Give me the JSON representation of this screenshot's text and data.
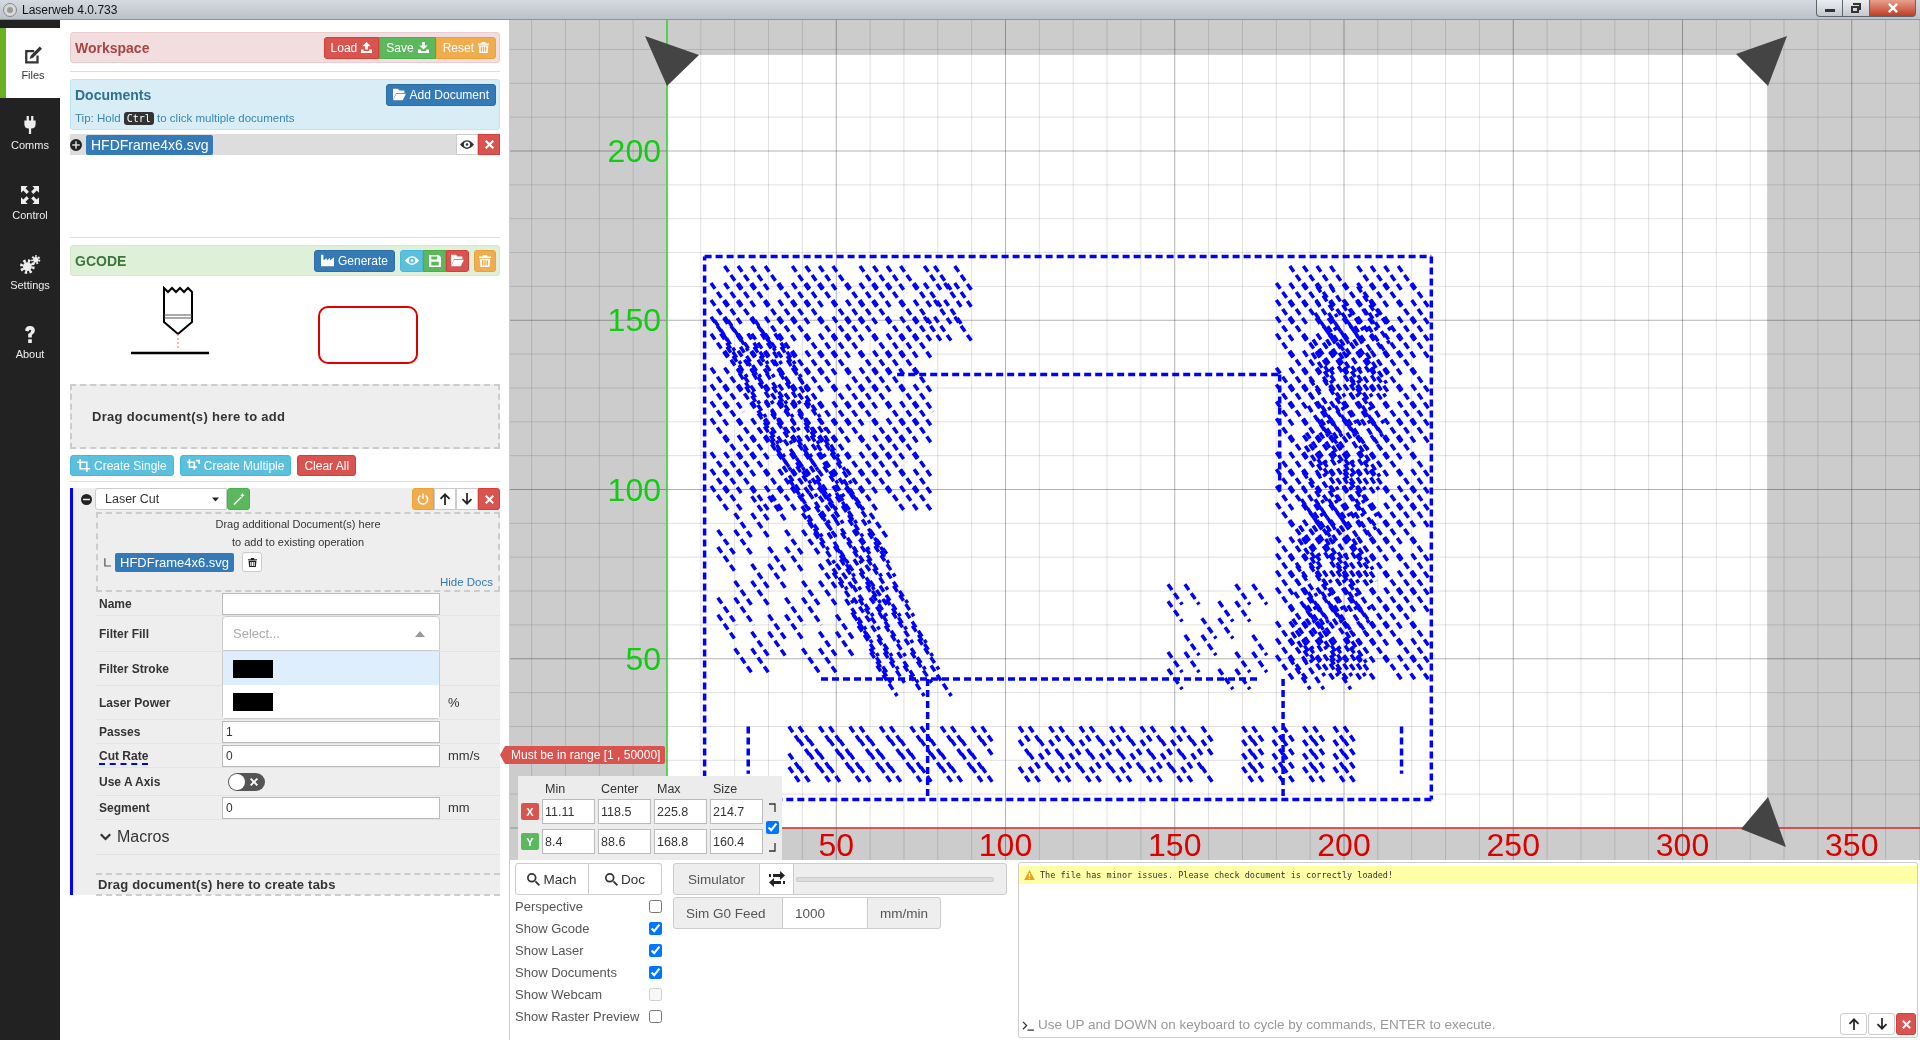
{
  "window": {
    "title": "Laserweb 4.0.733"
  },
  "nav": [
    {
      "label": "Files",
      "kind": "files",
      "selected": true
    },
    {
      "label": "Comms",
      "kind": "comms",
      "selected": false
    },
    {
      "label": "Control",
      "kind": "control",
      "selected": false
    },
    {
      "label": "Settings",
      "kind": "settings",
      "selected": false
    },
    {
      "label": "About",
      "kind": "about",
      "selected": false
    }
  ],
  "workspace": {
    "title": "Workspace",
    "buttons": [
      {
        "label": "Load",
        "kind": "load"
      },
      {
        "label": "Save",
        "kind": "save"
      },
      {
        "label": "Reset",
        "kind": "reset"
      }
    ]
  },
  "documents": {
    "title": "Documents",
    "add_button": "Add Document",
    "tip": {
      "before": "Tip: Hold",
      "key": "Ctrl",
      "after": "to click multiple documents"
    },
    "files": [
      {
        "name": "HFDFrame4x6.svg",
        "expanded": false
      }
    ]
  },
  "gcode": {
    "title": "GCODE",
    "generate_button": "Generate",
    "drop_hint": "Drag document(s) here to add"
  },
  "create_buttons": [
    {
      "label": "Create Single",
      "kind": "single"
    },
    {
      "label": "Create Multiple",
      "kind": "multiple"
    },
    {
      "label": "Clear All",
      "kind": "clear"
    }
  ],
  "operation": {
    "type": "Laser Cut",
    "expanded": true,
    "drop_hint": "Drag additional Document(s) here\nto add to existing operation",
    "documents": [
      {
        "name": "HFDFrame4x6.svg"
      }
    ],
    "hide_docs": "Hide Docs",
    "fields": [
      {
        "label": "Name",
        "kind": "text",
        "help": false
      },
      {
        "label": "Filter Fill",
        "kind": "select",
        "help": false,
        "placeholder": "Select...",
        "expanded": true,
        "options": [
          {
            "color": "#000000",
            "selected": true
          },
          {
            "color": "#000000",
            "selected": false
          }
        ]
      },
      {
        "label": "Filter Stroke",
        "kind": "label",
        "help": false
      },
      {
        "label": "Laser Power",
        "kind": "label",
        "help": false,
        "unit": "%"
      },
      {
        "label": "Passes",
        "kind": "number",
        "help": false,
        "value": "1"
      },
      {
        "label": "Cut Rate",
        "kind": "number",
        "help": true,
        "value": "0",
        "unit": "mm/s",
        "error": "Must be in range [1 , 50000]"
      },
      {
        "label": "Use A Axis",
        "kind": "toggle",
        "help": false,
        "on": false
      },
      {
        "label": "Segment",
        "kind": "number",
        "help": false,
        "value": "0",
        "unit": "mm"
      }
    ],
    "macros": "Macros",
    "tabs_hint": "Drag document(s) here to create tabs"
  },
  "canvas": {
    "y_labels": [
      "200",
      "150",
      "100",
      "50"
    ],
    "x_labels": [
      "50",
      "100",
      "150",
      "200",
      "250",
      "300",
      "350"
    ]
  },
  "bounds": {
    "headers": [
      "Min",
      "Center",
      "Max",
      "Size"
    ],
    "rows": [
      {
        "axis": "X",
        "color": "#d9534f",
        "values": [
          "11.11",
          "118.5",
          "225.8",
          "214.7"
        ]
      },
      {
        "axis": "Y",
        "color": "#5cb85c",
        "values": [
          "8.4",
          "88.6",
          "168.8",
          "160.4"
        ]
      }
    ],
    "linked": true
  },
  "view_buttons": [
    {
      "label": "Mach"
    },
    {
      "label": "Doc"
    }
  ],
  "view_options": [
    {
      "label": "Perspective",
      "checked": false,
      "disabled": false
    },
    {
      "label": "Show Gcode",
      "checked": true,
      "disabled": false
    },
    {
      "label": "Show Laser",
      "checked": true,
      "disabled": false
    },
    {
      "label": "Show Documents",
      "checked": true,
      "disabled": false
    },
    {
      "label": "Show Webcam",
      "checked": false,
      "disabled": true
    },
    {
      "label": "Show Raster Preview",
      "checked": false,
      "disabled": false
    }
  ],
  "simulator": {
    "label": "Simulator",
    "feed_label": "Sim G0 Feed",
    "feed_value": "1000",
    "feed_unit": "mm/min"
  },
  "console": {
    "messages": [
      {
        "kind": "warning",
        "text": "The file has minor issues. Please check document is correctly loaded!"
      }
    ],
    "placeholder": "Use UP and DOWN on keyboard to cycle by commands, ENTER to execute."
  }
}
